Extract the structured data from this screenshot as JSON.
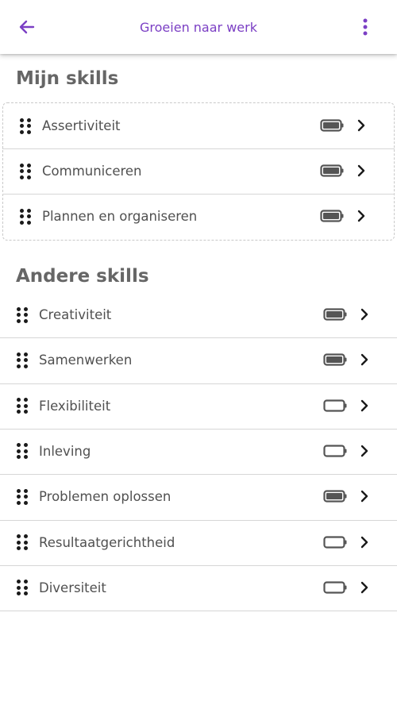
{
  "header": {
    "title": "Groeien naar werk",
    "back_icon": "arrow-left-icon",
    "menu_icon": "more-vertical-icon",
    "accent_color": "#7b3fc4"
  },
  "my_skills": {
    "title": "Mijn skills",
    "items": [
      {
        "label": "Assertiviteit",
        "level": "filled"
      },
      {
        "label": "Communiceren",
        "level": "filled"
      },
      {
        "label": "Plannen en organiseren",
        "level": "filled"
      }
    ]
  },
  "other_skills": {
    "title": "Andere skills",
    "items": [
      {
        "label": "Creativiteit",
        "level": "filled"
      },
      {
        "label": "Samenwerken",
        "level": "filled"
      },
      {
        "label": "Flexibiliteit",
        "level": "empty"
      },
      {
        "label": "Inleving",
        "level": "empty"
      },
      {
        "label": "Problemen oplossen",
        "level": "filled"
      },
      {
        "label": "Resultaatgerichtheid",
        "level": "empty"
      },
      {
        "label": "Diversiteit",
        "level": "empty"
      }
    ]
  },
  "icons": {
    "drag": "drag-handle-icon",
    "battery": "battery-icon",
    "chevron": "chevron-right-icon"
  }
}
